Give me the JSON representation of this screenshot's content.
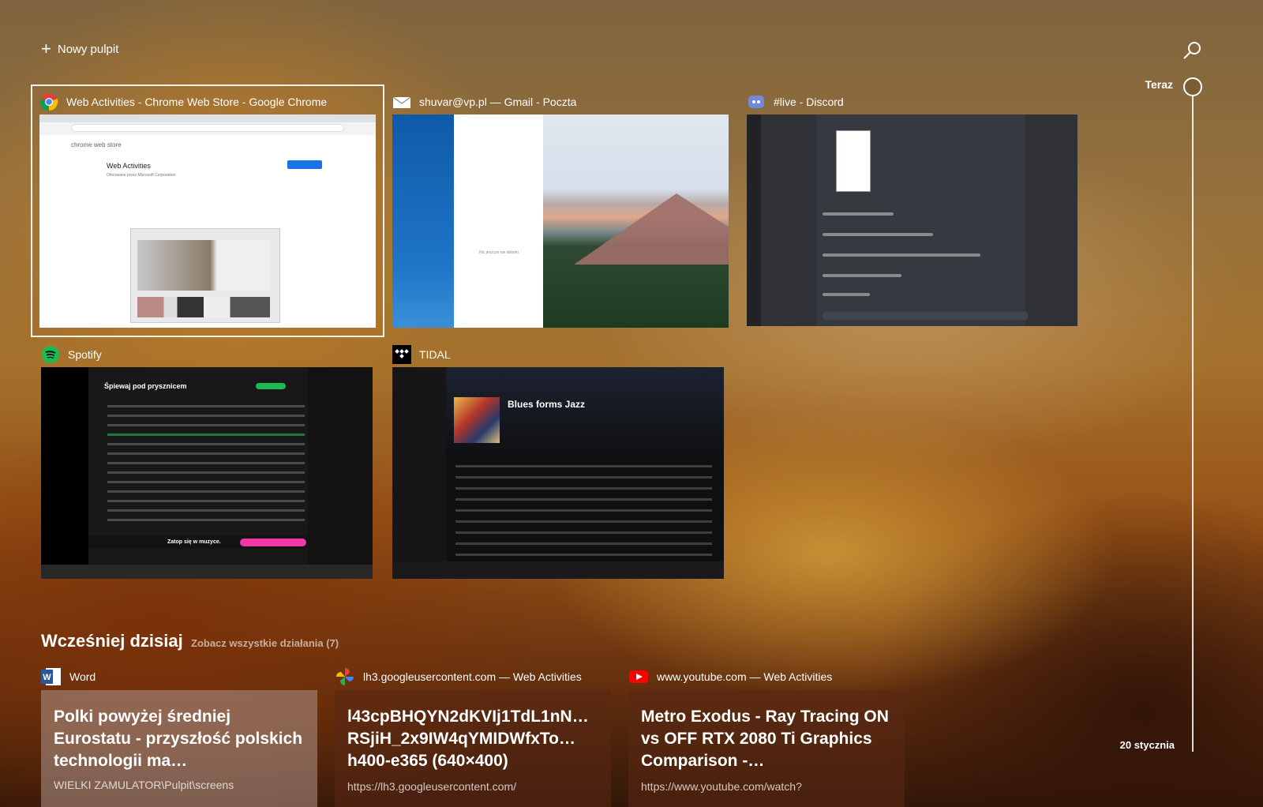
{
  "top": {
    "new_desktop_label": "Nowy pulpit"
  },
  "timeline": {
    "now_label": "Teraz",
    "date_label": "20 stycznia"
  },
  "windows": [
    {
      "title": "Web Activities - Chrome Web Store - Google Chrome",
      "icon": "chrome-icon",
      "selected": true
    },
    {
      "title": "shuvar@vp.pl — Gmail - Poczta",
      "icon": "mail-icon"
    },
    {
      "title": "#live - Discord",
      "icon": "discord-icon"
    },
    {
      "title": "Spotify",
      "icon": "spotify-icon"
    },
    {
      "title": "TIDAL",
      "icon": "tidal-icon"
    }
  ],
  "thumbs": {
    "chrome": {
      "store": "chrome web store",
      "title": "Web Activities",
      "sub": "Oferowane przez Microsoft Corporation"
    },
    "mail": {
      "empty": "Nic jeszcze nie dotarło"
    },
    "spotify": {
      "playlist": "Śpiewaj pod prysznicem",
      "banner": "Zatop się w muzyce."
    },
    "tidal": {
      "album": "Blues forms Jazz"
    }
  },
  "earlier": {
    "title": "Wcześniej dzisiaj",
    "see_all": "Zobacz wszystkie działania (7)",
    "cards": [
      {
        "app": "Word",
        "icon": "word-icon",
        "title": "Polki powyżej średniej Eurostatu - przyszłość polskich technologii ma…",
        "path": "WIELKI ZAMULATOR\\Pulpit\\screens"
      },
      {
        "app": "lh3.googleusercontent.com — Web Activities",
        "icon": "google-photos-icon",
        "title": "l43cpBHQYN2dKVIj1TdL1nN… RSjiH_2x9IW4qYMIDWfxTo… h400-e365 (640×400)",
        "url": "https://lh3.googleusercontent.com/"
      },
      {
        "app": "www.youtube.com — Web Activities",
        "icon": "youtube-icon",
        "title": "Metro Exodus - Ray Tracing ON vs OFF RTX 2080 Ti Graphics Comparison -…",
        "url": "https://www.youtube.com/watch?"
      }
    ]
  }
}
